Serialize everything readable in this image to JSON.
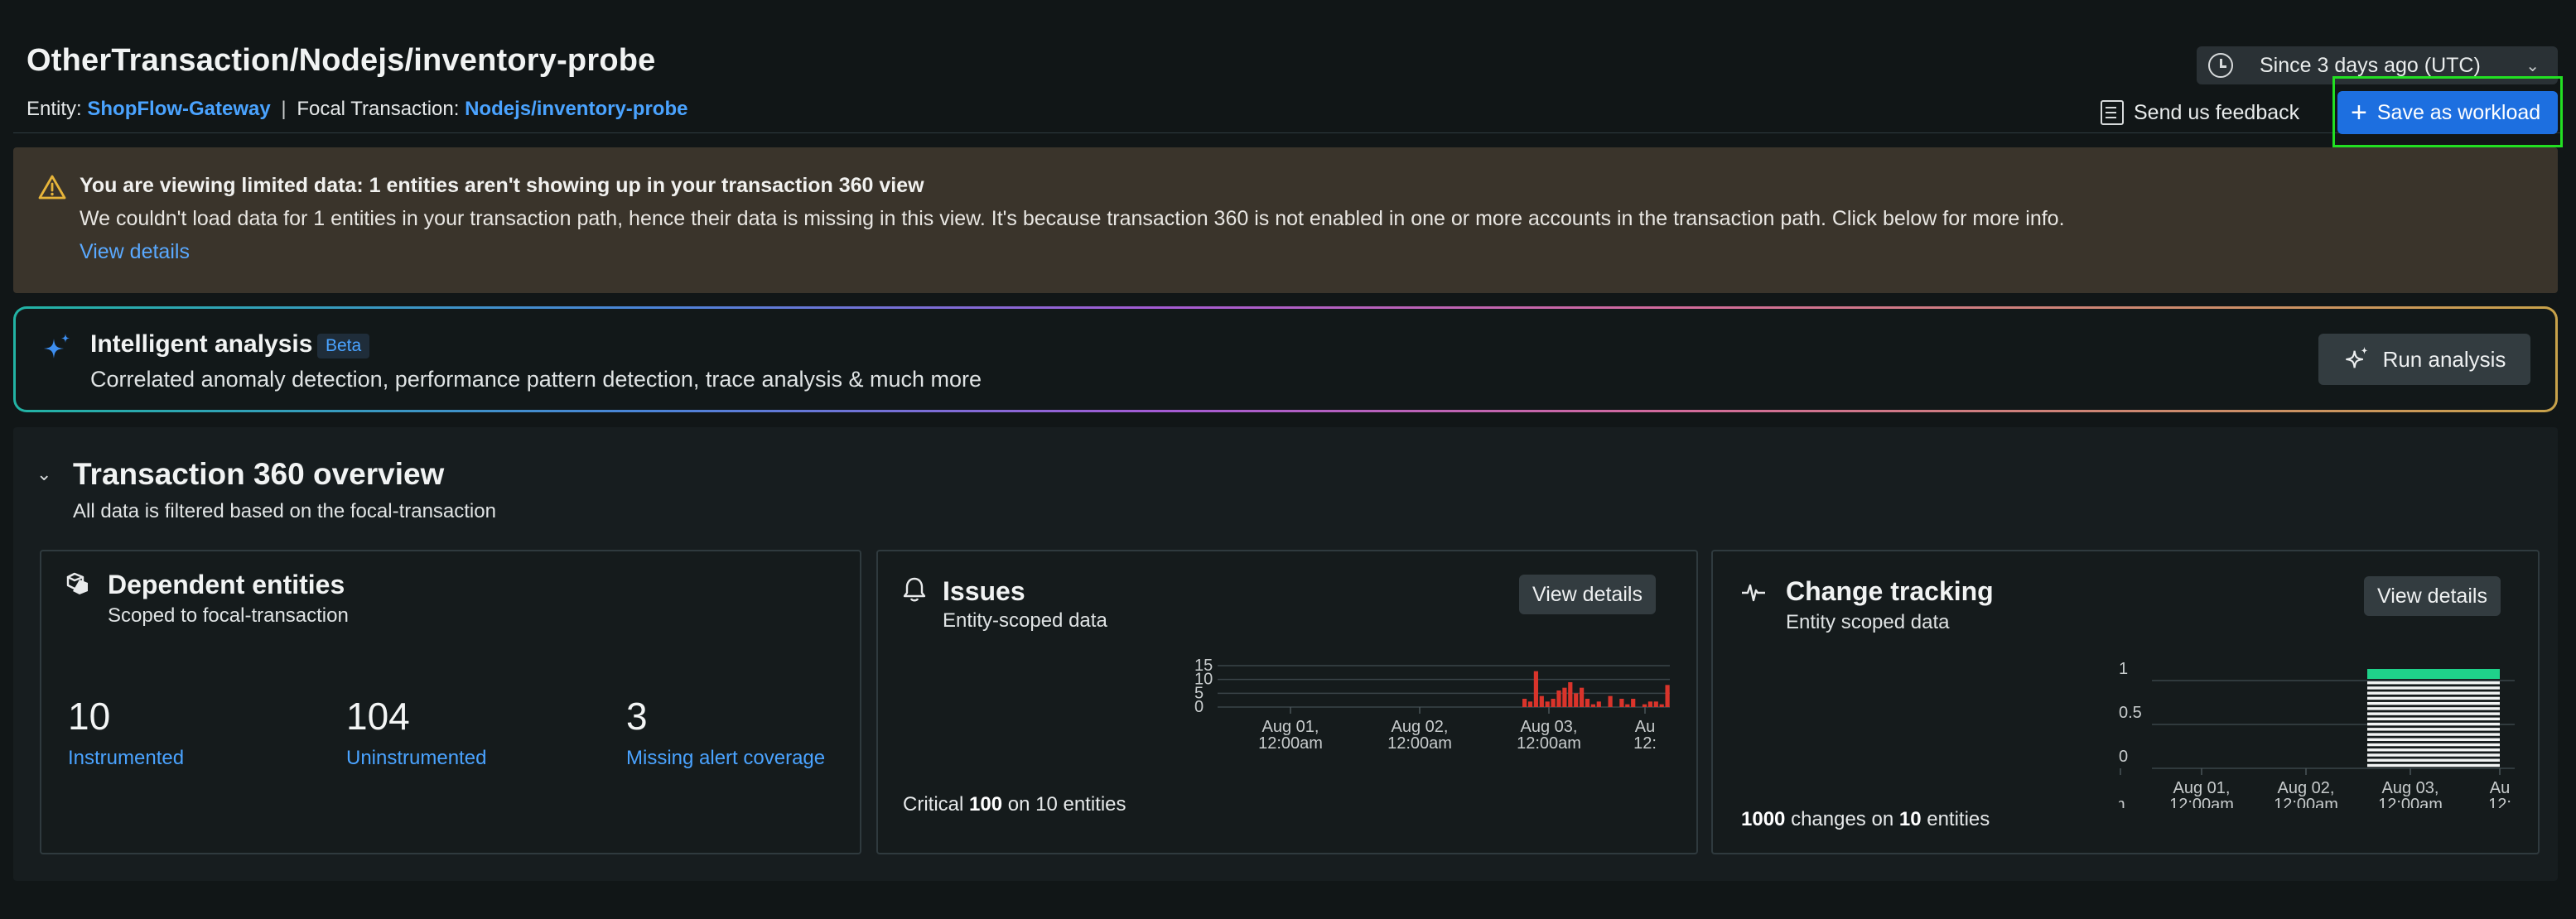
{
  "header": {
    "title": "OtherTransaction/Nodejs/inventory-probe",
    "entity_label": "Entity:",
    "entity_value": "ShopFlow-Gateway",
    "separator": "|",
    "focal_label": "Focal Transaction:",
    "focal_value": "Nodejs/inventory-probe",
    "time_range": "Since 3 days ago (UTC)",
    "feedback_label": "Send us feedback",
    "save_label": "Save as workload"
  },
  "warning": {
    "title": "You are viewing limited data: 1 entities aren't showing up in your transaction 360 view",
    "body": "We couldn't load data for 1 entities in your transaction path, hence their data is missing in this view. It's because transaction 360 is not enabled in one or more accounts in the transaction path. Click below for more info.",
    "link": "View details"
  },
  "intelligent_analysis": {
    "title": "Intelligent analysis",
    "badge": "Beta",
    "subtitle": "Correlated anomaly detection, performance pattern detection, trace analysis & much more",
    "button": "Run analysis"
  },
  "overview": {
    "title": "Transaction 360 overview",
    "subtitle": "All data is filtered based on the focal-transaction",
    "dependent": {
      "title": "Dependent entities",
      "subtitle": "Scoped to focal-transaction",
      "stats": [
        {
          "value": "10",
          "label": "Instrumented"
        },
        {
          "value": "104",
          "label": "Uninstrumented"
        },
        {
          "value": "3",
          "label": "Missing alert coverage"
        }
      ]
    },
    "issues": {
      "title": "Issues",
      "subtitle": "Entity-scoped data",
      "button": "View details",
      "footer_prefix": "Critical",
      "footer_count": "100",
      "footer_mid": "on",
      "footer_entities": "10",
      "footer_suffix": "entities"
    },
    "change_tracking": {
      "title": "Change tracking",
      "subtitle": "Entity scoped data",
      "button": "View details",
      "footer_count": "1000",
      "footer_mid": "changes on",
      "footer_entities": "10",
      "footer_suffix": "entities"
    }
  },
  "colors": {
    "accent": "#1d6fe0",
    "link": "#4aa3ff",
    "critical": "#d9342b",
    "change": "#1fd18a",
    "highlight": "#22e022"
  },
  "chart_data": [
    {
      "type": "bar",
      "y_ticks": [
        "15",
        "10",
        "5",
        "0"
      ],
      "x_ticks": [
        [
          "Aug 01,",
          "12:00am"
        ],
        [
          "Aug 02,",
          "12:00am"
        ],
        [
          "Aug 03,",
          "12:00am"
        ],
        [
          "Au",
          "12:"
        ]
      ],
      "ylim": [
        0,
        15
      ],
      "values": [
        3,
        2,
        13,
        4,
        2,
        3,
        6,
        7,
        9,
        5,
        7,
        3,
        1,
        2,
        0,
        4,
        0,
        3,
        1,
        3,
        0,
        1,
        2,
        2,
        1,
        8
      ],
      "color": "#d9342b"
    },
    {
      "type": "bar",
      "y_ticks": [
        "1",
        "0.5",
        "0"
      ],
      "x_ticks": [
        [
          "",
          "n"
        ],
        [
          "Aug 01,",
          "12:00am"
        ],
        [
          "Aug 02,",
          "12:00am"
        ],
        [
          "Aug 03,",
          "12:00am"
        ],
        [
          "Au",
          "12:"
        ]
      ],
      "ylim": [
        0,
        1
      ],
      "values": [
        1,
        1,
        1,
        1,
        1,
        1,
        1,
        1,
        1,
        1,
        1,
        1,
        1,
        1,
        1,
        1,
        1
      ],
      "color": "#1fd18a"
    }
  ]
}
